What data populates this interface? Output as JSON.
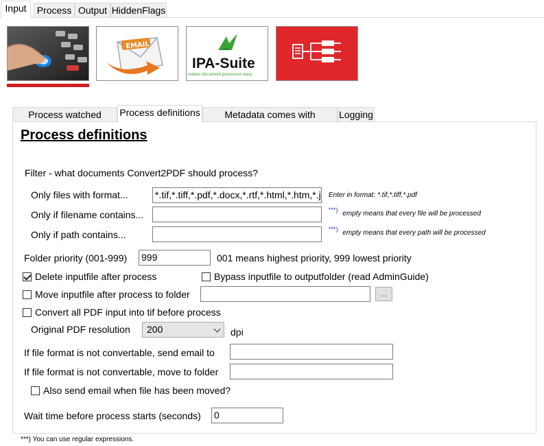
{
  "top_tabs": [
    "Input",
    "Process",
    "Output",
    "HiddenFlags"
  ],
  "image_buttons": {
    "email_text": "EMAIL",
    "ipa_title": "IPA-Suite",
    "ipa_tagline": "makes document processes easy"
  },
  "sub_tabs": [
    "Process watched folders",
    "Process definitions",
    "Metadata comes with document",
    "Logging"
  ],
  "panel": {
    "heading": "Process definitions",
    "filter_label": "Filter - what documents Convert2PDF should process?",
    "format_label": "Only files with format...",
    "format_value": "*.tif,*.tiff,*.pdf,*.docx,*.rtf,*.html,*.htm,*.jpg",
    "format_hint": "Enter in format: *.tif,*.tiff,*.pdf",
    "filename_label": "Only if filename contains...",
    "filename_value": "",
    "filename_hint": "empty means that every file will be processed",
    "path_label": "Only if path contains...",
    "path_value": "",
    "path_hint": "empty means that every path will be processed",
    "stars": "***)",
    "priority_label": "Folder priority (001-999)",
    "priority_value": "999",
    "priority_hint": "001 means highest priority, 999 lowest priority",
    "delete_label": "Delete inputfile after process",
    "delete_checked": true,
    "bypass_label": "Bypass inputfile to outputfolder (read AdminGuide)",
    "bypass_checked": false,
    "move_label": "Move inputfile after process to folder",
    "move_checked": false,
    "move_value": "",
    "browse_label": "...",
    "convert_label": "Convert all PDF input into tif before process",
    "convert_checked": false,
    "resolution_label": "Original PDF resolution",
    "resolution_value": "200",
    "resolution_unit": "dpi",
    "email_label": "If file format is not convertable, send email to",
    "email_value": "",
    "movefolder_label": "If file format is not convertable, move to folder",
    "movefolder_value": "",
    "also_email_label": "Also send email when file has been moved?",
    "also_email_checked": false,
    "wait_label": "Wait time before process starts (seconds)",
    "wait_value": "0"
  },
  "footnote": "***) You can use regular expressions.",
  "colors": {
    "accent_red": "#cf1f1f",
    "flow_red": "#e0282c",
    "ipa_green": "#3aa535"
  }
}
